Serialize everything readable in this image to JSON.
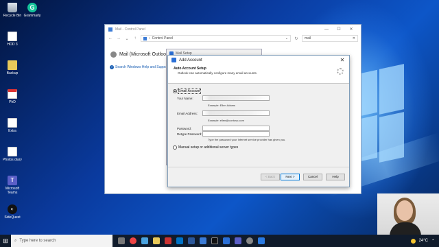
{
  "desktop": {
    "icons": [
      {
        "label": "Recycle Bin",
        "icon": "recycle-bin-icon"
      },
      {
        "label": "Grammarly",
        "icon": "grammarly-icon"
      },
      {
        "label": "HOD 3",
        "icon": "document-icon"
      },
      {
        "label": "Backup",
        "icon": "folder-icon"
      },
      {
        "label": "PhD",
        "icon": "pdf-icon"
      },
      {
        "label": "Extra",
        "icon": "document-icon"
      },
      {
        "label": "Photos diary",
        "icon": "document-icon"
      },
      {
        "label": "Microsoft Teams",
        "icon": "teams-icon"
      },
      {
        "label": "SideQuest",
        "icon": "sidequest-icon"
      }
    ]
  },
  "control_panel": {
    "title": "Mail - Control Panel",
    "address": "Control Panel",
    "search_value": "mail",
    "heading": "Mail (Microsoft Outlook)",
    "help_link": "Search Windows Help and Support",
    "controls": {
      "minimize": "—",
      "maximize": "☐",
      "close": "✕"
    }
  },
  "mail_setup": {
    "title": "Mail Setup"
  },
  "add_account": {
    "title": "Add Account",
    "header_title": "Auto Account Setup",
    "header_subtitle": "Outlook can automatically configure many email accounts.",
    "close": "✕",
    "email_account_option": "Email Account",
    "your_name_label": "Your Name:",
    "your_name_hint": "Example: Ellen Adams",
    "email_label": "Email Address:",
    "email_hint": "Example: ellen@contoso.com",
    "password_label": "Password:",
    "retype_label": "Retype Password:",
    "password_hint": "Type the password your Internet service provider has given you.",
    "manual_option": "Manual setup or additional server types",
    "buttons": {
      "back": "< Back",
      "next": "Next >",
      "cancel": "Cancel",
      "help": "Help"
    }
  },
  "taskbar": {
    "search_placeholder": "Type here to search",
    "temperature": "24°C"
  },
  "colors": {
    "accent": "#0078d7",
    "link": "#1a5fb4"
  }
}
